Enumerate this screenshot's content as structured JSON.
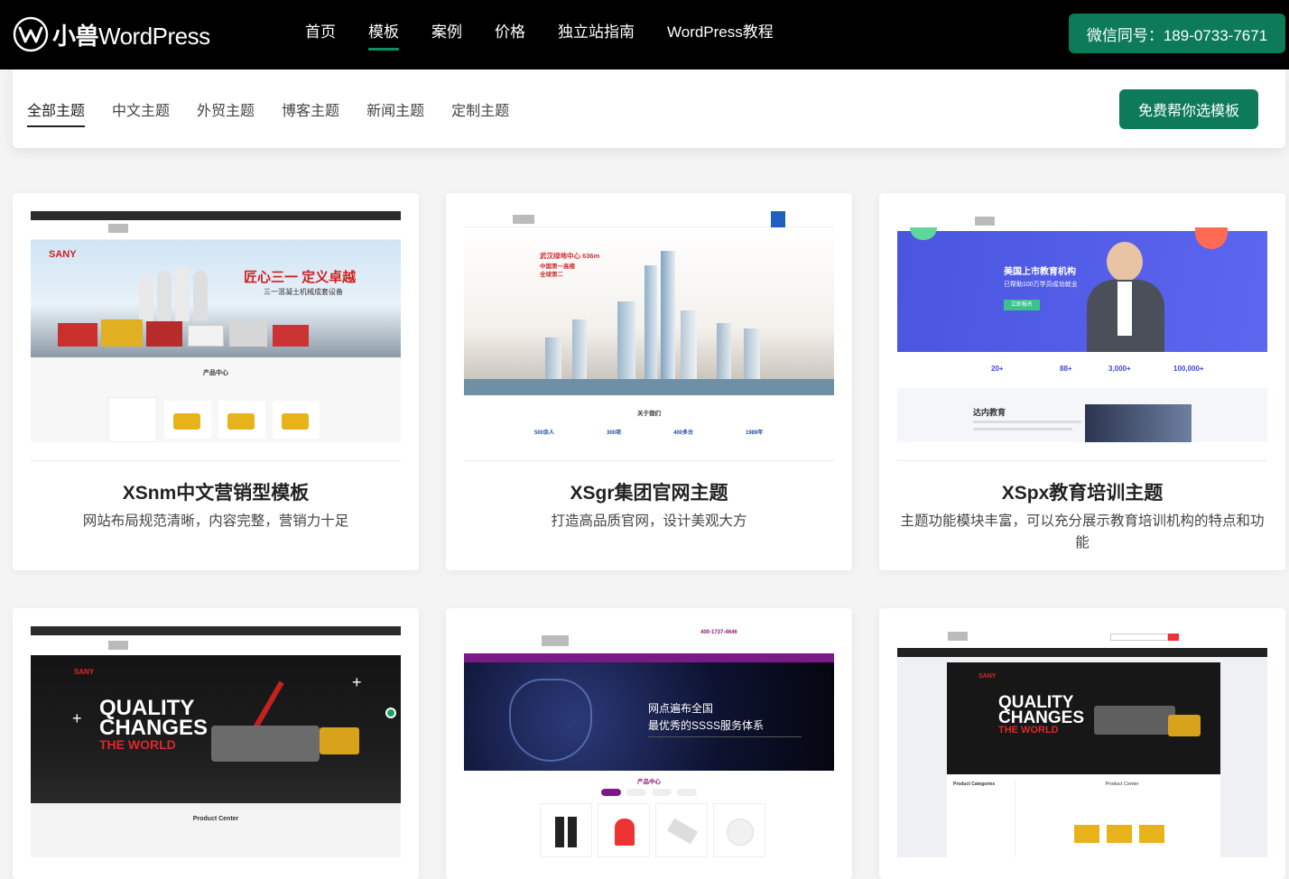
{
  "header": {
    "logo_cn": "小兽",
    "logo_en": "WordPress",
    "nav": [
      {
        "label": "首页"
      },
      {
        "label": "模板"
      },
      {
        "label": "案例"
      },
      {
        "label": "价格"
      },
      {
        "label": "独立站指南"
      },
      {
        "label": "WordPress教程"
      }
    ],
    "contact_label": "微信同号：189-0733-7671"
  },
  "filters": {
    "tabs": [
      {
        "label": "全部主题"
      },
      {
        "label": "中文主题"
      },
      {
        "label": "外贸主题"
      },
      {
        "label": "博客主题"
      },
      {
        "label": "新闻主题"
      },
      {
        "label": "定制主题"
      }
    ],
    "help_label": "免费帮你选模板"
  },
  "cards": [
    {
      "title": "XSnm中文营销型模板",
      "desc": "网站布局规范清晰，内容完整，营销力十足",
      "thumb": {
        "brand": "SANY",
        "headline": "匠心三一 定义卓越",
        "sub": "三一混凝土机械成套设备",
        "section": "产品中心"
      }
    },
    {
      "title": "XSgr集团官网主题",
      "desc": "打造高品质官网，设计美观大方",
      "thumb": {
        "headline": "武汉绿地中心 636m",
        "sub": "中国第一高楼",
        "sub2": "全球第二",
        "section": "关于我们",
        "stats": [
          "500余人",
          "300项",
          "400多台",
          "1989年"
        ]
      }
    },
    {
      "title": "XSpx教育培训主题",
      "desc": "主题功能模块丰富，可以充分展示教育培训机构的特点和功能",
      "thumb": {
        "headline": "美国上市教育机构",
        "sub": "已帮助100万学员成功就业",
        "cta": "立即报名",
        "stats": [
          "20+",
          "88+",
          "3,000+",
          "100,000+"
        ],
        "section": "达内教育"
      }
    },
    {
      "title": "",
      "desc": "",
      "thumb": {
        "brand": "SANY",
        "headline1": "QUALITY",
        "headline2": "CHANGES",
        "headline3": "THE WORLD",
        "section": "Product Center"
      }
    },
    {
      "title": "",
      "desc": "",
      "thumb": {
        "phone": "400-1737-4646",
        "headline": "网点遍布全国",
        "sub": "最优秀的SSSS服务体系",
        "section": "产品中心"
      }
    },
    {
      "title": "",
      "desc": "",
      "thumb": {
        "brand": "SANY",
        "headline1": "QUALITY",
        "headline2": "CHANGES",
        "headline3": "THE WORLD",
        "section": "Product Center",
        "side": "Product Categories"
      }
    }
  ],
  "colors": {
    "accent": "#0d7a5a",
    "header_bg": "#000000"
  }
}
